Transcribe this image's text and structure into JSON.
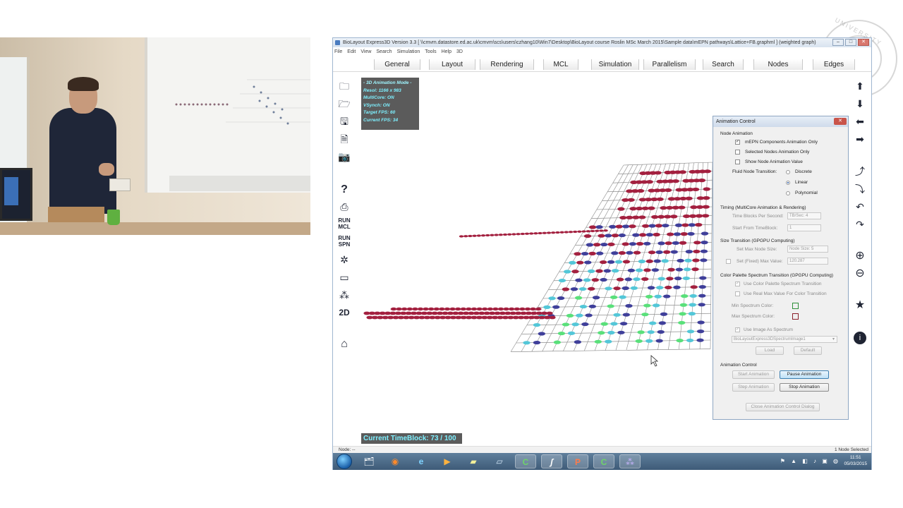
{
  "window": {
    "title": "BioLayout Express3D Version 3.3  [ \\\\cmvm.datastore.ed.ac.uk\\cmvm\\scs\\users\\czhang10\\Win7\\Desktop\\BioLayout course Roslin MSc March 2015\\Sample data\\mEPN pathways\\Lattice+FB.graphml ] (weighted graph)",
    "controls": [
      "–",
      "□",
      "✕"
    ]
  },
  "menu": [
    "File",
    "Edit",
    "View",
    "Search",
    "Simulation",
    "Tools",
    "Help",
    "3D"
  ],
  "tabs": [
    "General",
    "Layout",
    "Rendering",
    "MCL",
    "Simulation",
    "Parallelism",
    "Search",
    "Nodes",
    "Edges"
  ],
  "left_toolbar": [
    {
      "icon": "open-folder-icon",
      "glyph": "🗀"
    },
    {
      "icon": "folder-icon",
      "glyph": "🗁"
    },
    {
      "icon": "save-icon",
      "glyph": "🖫"
    },
    {
      "icon": "document-icon",
      "glyph": "🗎"
    },
    {
      "icon": "camera-icon",
      "glyph": "📷"
    },
    {
      "icon": "help-icon",
      "glyph": "?"
    },
    {
      "icon": "print-icon",
      "glyph": "⎙"
    },
    {
      "icon": "run-mcl-icon",
      "glyph": "RUN\nMCL"
    },
    {
      "icon": "run-spn-icon",
      "glyph": "RUN\nSPN"
    },
    {
      "icon": "settings-icon",
      "glyph": "✲"
    },
    {
      "icon": "console-icon",
      "glyph": "▭"
    },
    {
      "icon": "network-icon",
      "glyph": "⁂"
    },
    {
      "icon": "2d-icon",
      "glyph": "2D"
    },
    {
      "icon": "home-icon",
      "glyph": "⌂"
    }
  ],
  "right_toolbar": [
    {
      "icon": "arrow-up-icon",
      "glyph": "⬆"
    },
    {
      "icon": "arrow-down-icon",
      "glyph": "⬇"
    },
    {
      "icon": "arrow-left-icon",
      "glyph": "⬅"
    },
    {
      "icon": "arrow-right-icon",
      "glyph": "➡"
    },
    {
      "icon": "rotate-up-icon",
      "glyph": "⤴"
    },
    {
      "icon": "rotate-down-icon",
      "glyph": "⤵"
    },
    {
      "icon": "rotate-left-icon",
      "glyph": "↶"
    },
    {
      "icon": "rotate-right-icon",
      "glyph": "↷"
    },
    {
      "icon": "zoom-in-icon",
      "glyph": "⊕"
    },
    {
      "icon": "zoom-out-icon",
      "glyph": "⊖"
    },
    {
      "icon": "star-icon",
      "glyph": "★"
    },
    {
      "icon": "info-icon",
      "glyph": "i"
    }
  ],
  "overlay": {
    "mode": "- 3D Animation Mode -",
    "resol": "Resol:     1166 x 983",
    "multicore": "MultiCore: ON",
    "vsynch": "VSynch: ON",
    "target_fps": "Target FPS:  60",
    "current_fps": "Current FPS:  34"
  },
  "timeblock": "Current TimeBlock: 73 / 100",
  "status": {
    "left": "Node: --",
    "right": "1 Node Selected"
  },
  "dialog": {
    "title": "Animation Control",
    "node_animation_label": "Node Animation",
    "mepn_only": "mEPN Components Animation Only",
    "selected_only": "Selected Nodes Animation Only",
    "show_value": "Show Node Animation Value",
    "fluid_transition": "Fluid Node Transition:",
    "discrete": "Discrete",
    "linear": "Linear",
    "polynomial": "Polynomial",
    "timing_label": "Timing  (MultiCore Animation & Rendering)",
    "time_blocks": "Time Blocks Per Second:",
    "time_blocks_value": "TB/Sec: 4",
    "start_from": "Start From TimeBlock:",
    "start_from_value": "1",
    "size_transition": "Size Transition  (GPGPU Computing)",
    "max_node_size": "Set Max Node Size:",
    "max_node_size_value": "Node Size: 5",
    "fixed_max": "Set (Fixed) Max Value:",
    "fixed_max_value": "120.287",
    "color_palette": "Color Palette Spectrum Transition  (GPGPU Computing)",
    "use_color_palette": "Use Color Palette Spectrum Transition",
    "use_real_max": "Use Real Max Value For Color Transition",
    "min_spectrum": "Min Spectrum Color:",
    "max_spectrum": "Max Spectrum Color:",
    "min_color": "#2f8f3a",
    "max_color": "#8a1f2a",
    "use_image": "Use Image As Spectrum",
    "image_select": "BioLayoutExpress3DSpectrumImage1",
    "load": "Load",
    "default": "Default",
    "animation_control_label": "Animation Control",
    "start": "Start Animation",
    "pause": "Pause Animation",
    "step": "Step Animation",
    "stop": "Stop Animation",
    "close": "Close Animation Control Dialog"
  },
  "taskbar": {
    "apps": [
      {
        "icon": "explorer-icon",
        "glyph": "🗂"
      },
      {
        "icon": "firefox-icon",
        "glyph": "◉"
      },
      {
        "icon": "ie-icon",
        "glyph": "e"
      },
      {
        "icon": "media-player-icon",
        "glyph": "▶"
      },
      {
        "icon": "notes-icon",
        "glyph": "▰"
      },
      {
        "icon": "tablet-icon",
        "glyph": "▱"
      },
      {
        "icon": "camtasia-icon",
        "glyph": "C"
      },
      {
        "icon": "java-icon",
        "glyph": "ʃ"
      },
      {
        "icon": "powerpoint-icon",
        "glyph": "P"
      },
      {
        "icon": "camtasia-recorder-icon",
        "glyph": "C"
      },
      {
        "icon": "biolayout-icon",
        "glyph": "⁂"
      }
    ],
    "time": "11:51",
    "date": "05/03/2015"
  },
  "watermark": "UNIVERSITY"
}
